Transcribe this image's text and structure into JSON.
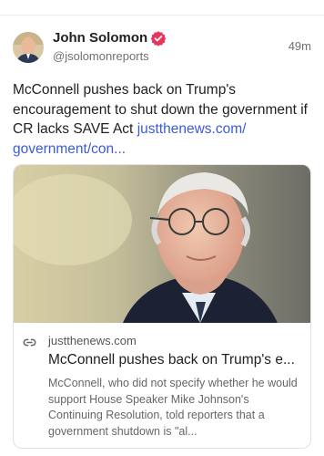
{
  "post": {
    "author_name": "John Solomon",
    "handle": "@jsolomonreports",
    "timestamp": "49m",
    "text": "McConnell pushes back on Trump's encouragement to shut down the government if CR lacks SAVE Act",
    "link_text": "justthenews.com/​government/con...",
    "verified_icon": "verified-badge-icon",
    "colors": {
      "link": "#3b5bd8",
      "verified": "#e8345a"
    }
  },
  "link_card": {
    "domain": "justthenews.com",
    "title": "McConnell pushes back on Trump's e...",
    "description": "McConnell, who did not specify whether he would support House Speaker Mike Johnson's Continuing Resolution, told reporters that a government shutdown is \"al...",
    "icon": "link-icon"
  }
}
